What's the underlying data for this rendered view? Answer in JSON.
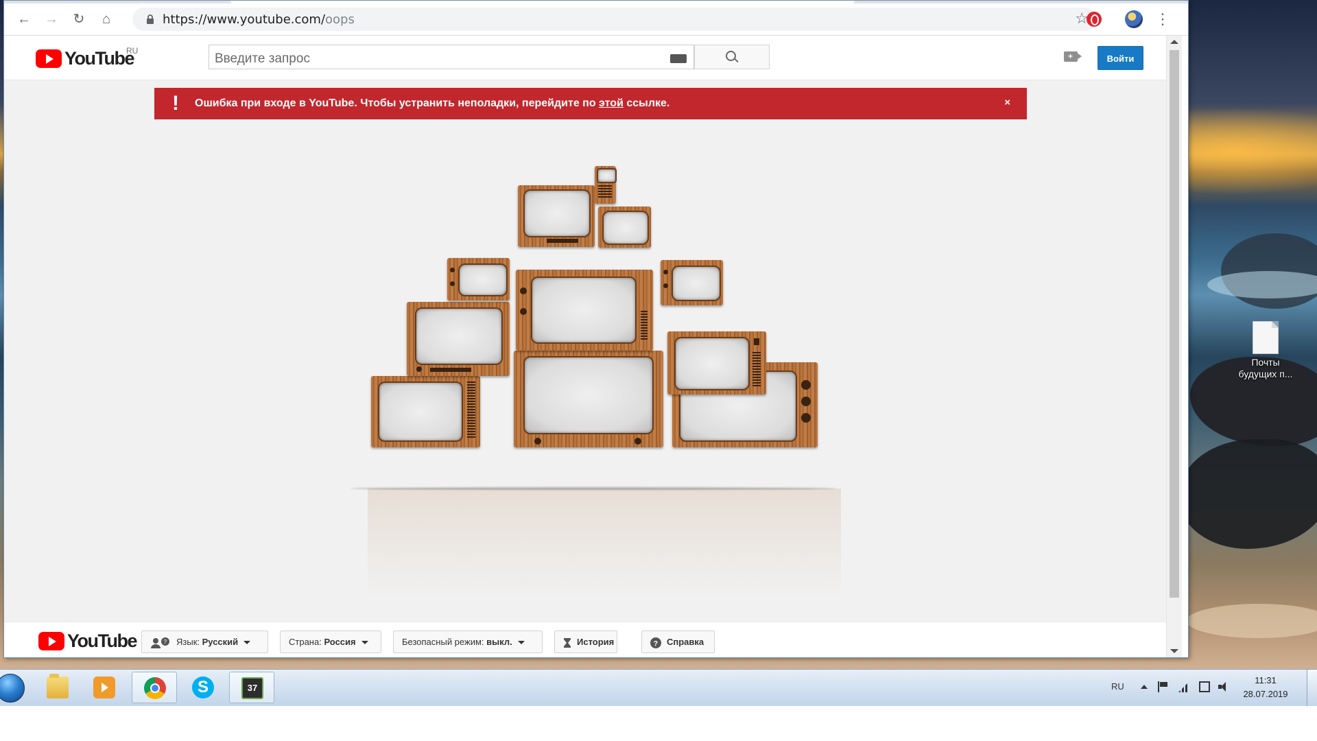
{
  "browser": {
    "url_host": "https://www.youtube.com/",
    "url_path": "oops"
  },
  "youtube": {
    "logo_text": "YouTube",
    "country_code": "RU",
    "search_placeholder": "Введите запрос",
    "signin_label": "Войти",
    "error": {
      "text_before": "Ошибка при входе в YouTube. Чтобы устранить неполадки, перейдите по ",
      "link_text": "этой",
      "text_after": " ссылке.",
      "icon": "!",
      "close": "×"
    },
    "footer": {
      "language_label": "Язык:",
      "language_value": "Русский",
      "country_label": "Страна:",
      "country_value": "Россия",
      "safety_label": "Безопасный режим:",
      "safety_value": "выкл.",
      "history_label": "История",
      "help_label": "Справка"
    }
  },
  "desktop": {
    "file_name": "Почты будущих п..."
  },
  "taskbar": {
    "film_badge": "37",
    "skype_letter": "S",
    "language": "RU",
    "time": "11:31",
    "date": "28.07.2019"
  },
  "colors": {
    "error_bar": "#c1272d",
    "signin": "#167ac6",
    "youtube_red": "#ff0000"
  }
}
